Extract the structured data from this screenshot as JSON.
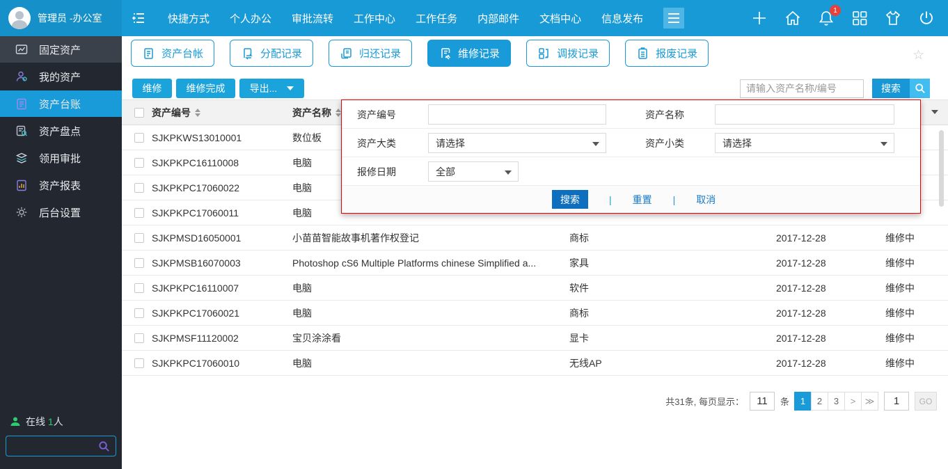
{
  "colors": {
    "topbar_blue": "#189ad7",
    "sidebar_dark": "#232830",
    "accent_blue": "#1a9bd7",
    "panel_border_red": "#e60000",
    "panel_search_blue": "#0d6fbe",
    "online_green": "#2ecc71",
    "badge_red": "#e8413c"
  },
  "topbar": {
    "user_name": "管理员 -办公室",
    "nav_items": [
      {
        "label": "快捷方式"
      },
      {
        "label": "个人办公"
      },
      {
        "label": "审批流转"
      },
      {
        "label": "工作中心"
      },
      {
        "label": "工作任务"
      },
      {
        "label": "内部邮件"
      },
      {
        "label": "文档中心"
      },
      {
        "label": "信息发布"
      }
    ],
    "notification_badge": "1"
  },
  "sidebar": {
    "items": [
      {
        "label": "固定资产",
        "icon": "chart-icon"
      },
      {
        "label": "我的资产",
        "icon": "user-icon"
      },
      {
        "label": "资产台账",
        "icon": "ledger-icon",
        "active": true
      },
      {
        "label": "资产盘点",
        "icon": "inventory-icon"
      },
      {
        "label": "领用审批",
        "icon": "approval-icon"
      },
      {
        "label": "资产报表",
        "icon": "report-icon"
      },
      {
        "label": "后台设置",
        "icon": "settings-icon"
      }
    ],
    "online": {
      "prefix": "在线",
      "count": "1",
      "suffix": "人"
    }
  },
  "tabs": [
    {
      "label": "资产台帐"
    },
    {
      "label": "分配记录"
    },
    {
      "label": "归还记录"
    },
    {
      "label": "维修记录",
      "active": true
    },
    {
      "label": "调拨记录"
    },
    {
      "label": "报废记录"
    }
  ],
  "toolbar": {
    "repair_button": "维修",
    "repair_done_button": "维修完成",
    "export_button": "导出...",
    "search_placeholder": "请输入资产名称/编号",
    "search_button": "搜索"
  },
  "filter_panel": {
    "asset_no_label": "资产编号",
    "asset_name_label": "资产名称",
    "major_label": "资产大类",
    "minor_label": "资产小类",
    "date_label": "报修日期",
    "select_placeholder": "请选择",
    "date_value": "全部",
    "search_button": "搜索",
    "reset_button": "重置",
    "cancel_button": "取消"
  },
  "table": {
    "header_asset_no": "资产编号",
    "header_asset_name": "资产名称",
    "rows": [
      {
        "no": "SJKPKWS13010001",
        "name": "数位板",
        "cat": "",
        "date": "",
        "status": ""
      },
      {
        "no": "SJKPKPC16110008",
        "name": "电脑",
        "cat": "",
        "date": "",
        "status": ""
      },
      {
        "no": "SJKPKPC17060022",
        "name": "电脑",
        "cat": "",
        "date": "",
        "status": ""
      },
      {
        "no": "SJKPKPC17060011",
        "name": "电脑",
        "cat": "",
        "date": "",
        "status": ""
      },
      {
        "no": "SJKPMSD16050001",
        "name": "小苗苗智能故事机著作权登记",
        "cat": "商标",
        "date": "2017-12-28",
        "status": "维修中"
      },
      {
        "no": "SJKPMSB16070003",
        "name": "Photoshop cS6 Multiple Platforms chinese Simplified a...",
        "cat": "家具",
        "date": "2017-12-28",
        "status": "维修中"
      },
      {
        "no": "SJKPKPC16110007",
        "name": "电脑",
        "cat": "软件",
        "date": "2017-12-28",
        "status": "维修中"
      },
      {
        "no": "SJKPKPC17060021",
        "name": "电脑",
        "cat": "商标",
        "date": "2017-12-28",
        "status": "维修中"
      },
      {
        "no": "SJKPMSF11120002",
        "name": "宝贝涂涂看",
        "cat": "显卡",
        "date": "2017-12-28",
        "status": "维修中"
      },
      {
        "no": "SJKPKPC17060010",
        "name": "电脑",
        "cat": "无线AP",
        "date": "2017-12-28",
        "status": "维修中"
      }
    ]
  },
  "pagination": {
    "total_text": "共31条, 每页显示：",
    "page_size": "11",
    "unit": "条",
    "pages": [
      {
        "label": "1",
        "active": true
      },
      {
        "label": "2",
        "active": false
      },
      {
        "label": "3",
        "active": false
      }
    ],
    "next": ">",
    "last": "≫",
    "goto_value": "1",
    "go_button": "GO"
  }
}
